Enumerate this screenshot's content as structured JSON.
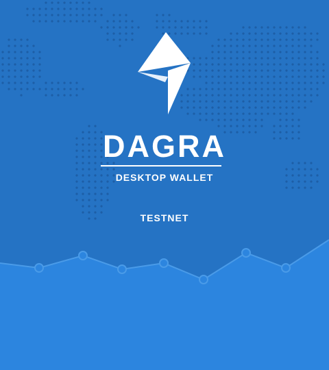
{
  "app": {
    "brand": "DAGRA",
    "subtitle": "DESKTOP WALLET",
    "network": "TESTNET"
  },
  "icons": {
    "logo": "lightning-bolt-logo",
    "background_map": "dotted-world-map",
    "background_chart": "line-chart-decoration"
  },
  "colors": {
    "background": "#2573c4",
    "chart_fill": "#2c85df",
    "chart_line": "#4a9be8",
    "map_dots": "#1d5ea6",
    "text": "#ffffff"
  }
}
